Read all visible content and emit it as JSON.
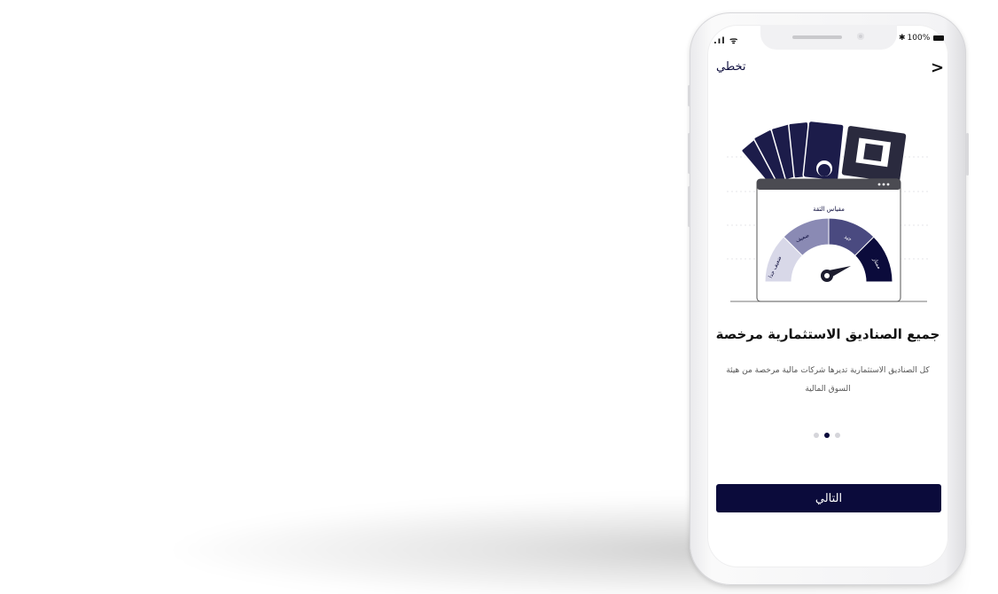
{
  "status_bar": {
    "signal": ".ıl ᯤ",
    "battery": "100%",
    "bluetooth": "✱"
  },
  "header": {
    "skip_label": "تخطي",
    "back_icon": "chevron-right-icon"
  },
  "illustration": {
    "gauge_title": "مقياس الثقة",
    "segments": [
      "ضعيف جدا",
      "ضعيف",
      "جيد",
      "ممتاز"
    ],
    "colors": {
      "navy": "#0b0b3b",
      "mid": "#4a4a80",
      "light": "#8a8ab4",
      "pale": "#d8d8e8"
    }
  },
  "onboarding": {
    "title": "جميع الصناديق الاستثمارية مرخصة",
    "description": "كل الصناديق الاستثمارية تديرها شركات مالية مرخصة من هيئة السوق المالية",
    "page_index": 2,
    "page_count": 3
  },
  "actions": {
    "next_label": "التالي"
  }
}
